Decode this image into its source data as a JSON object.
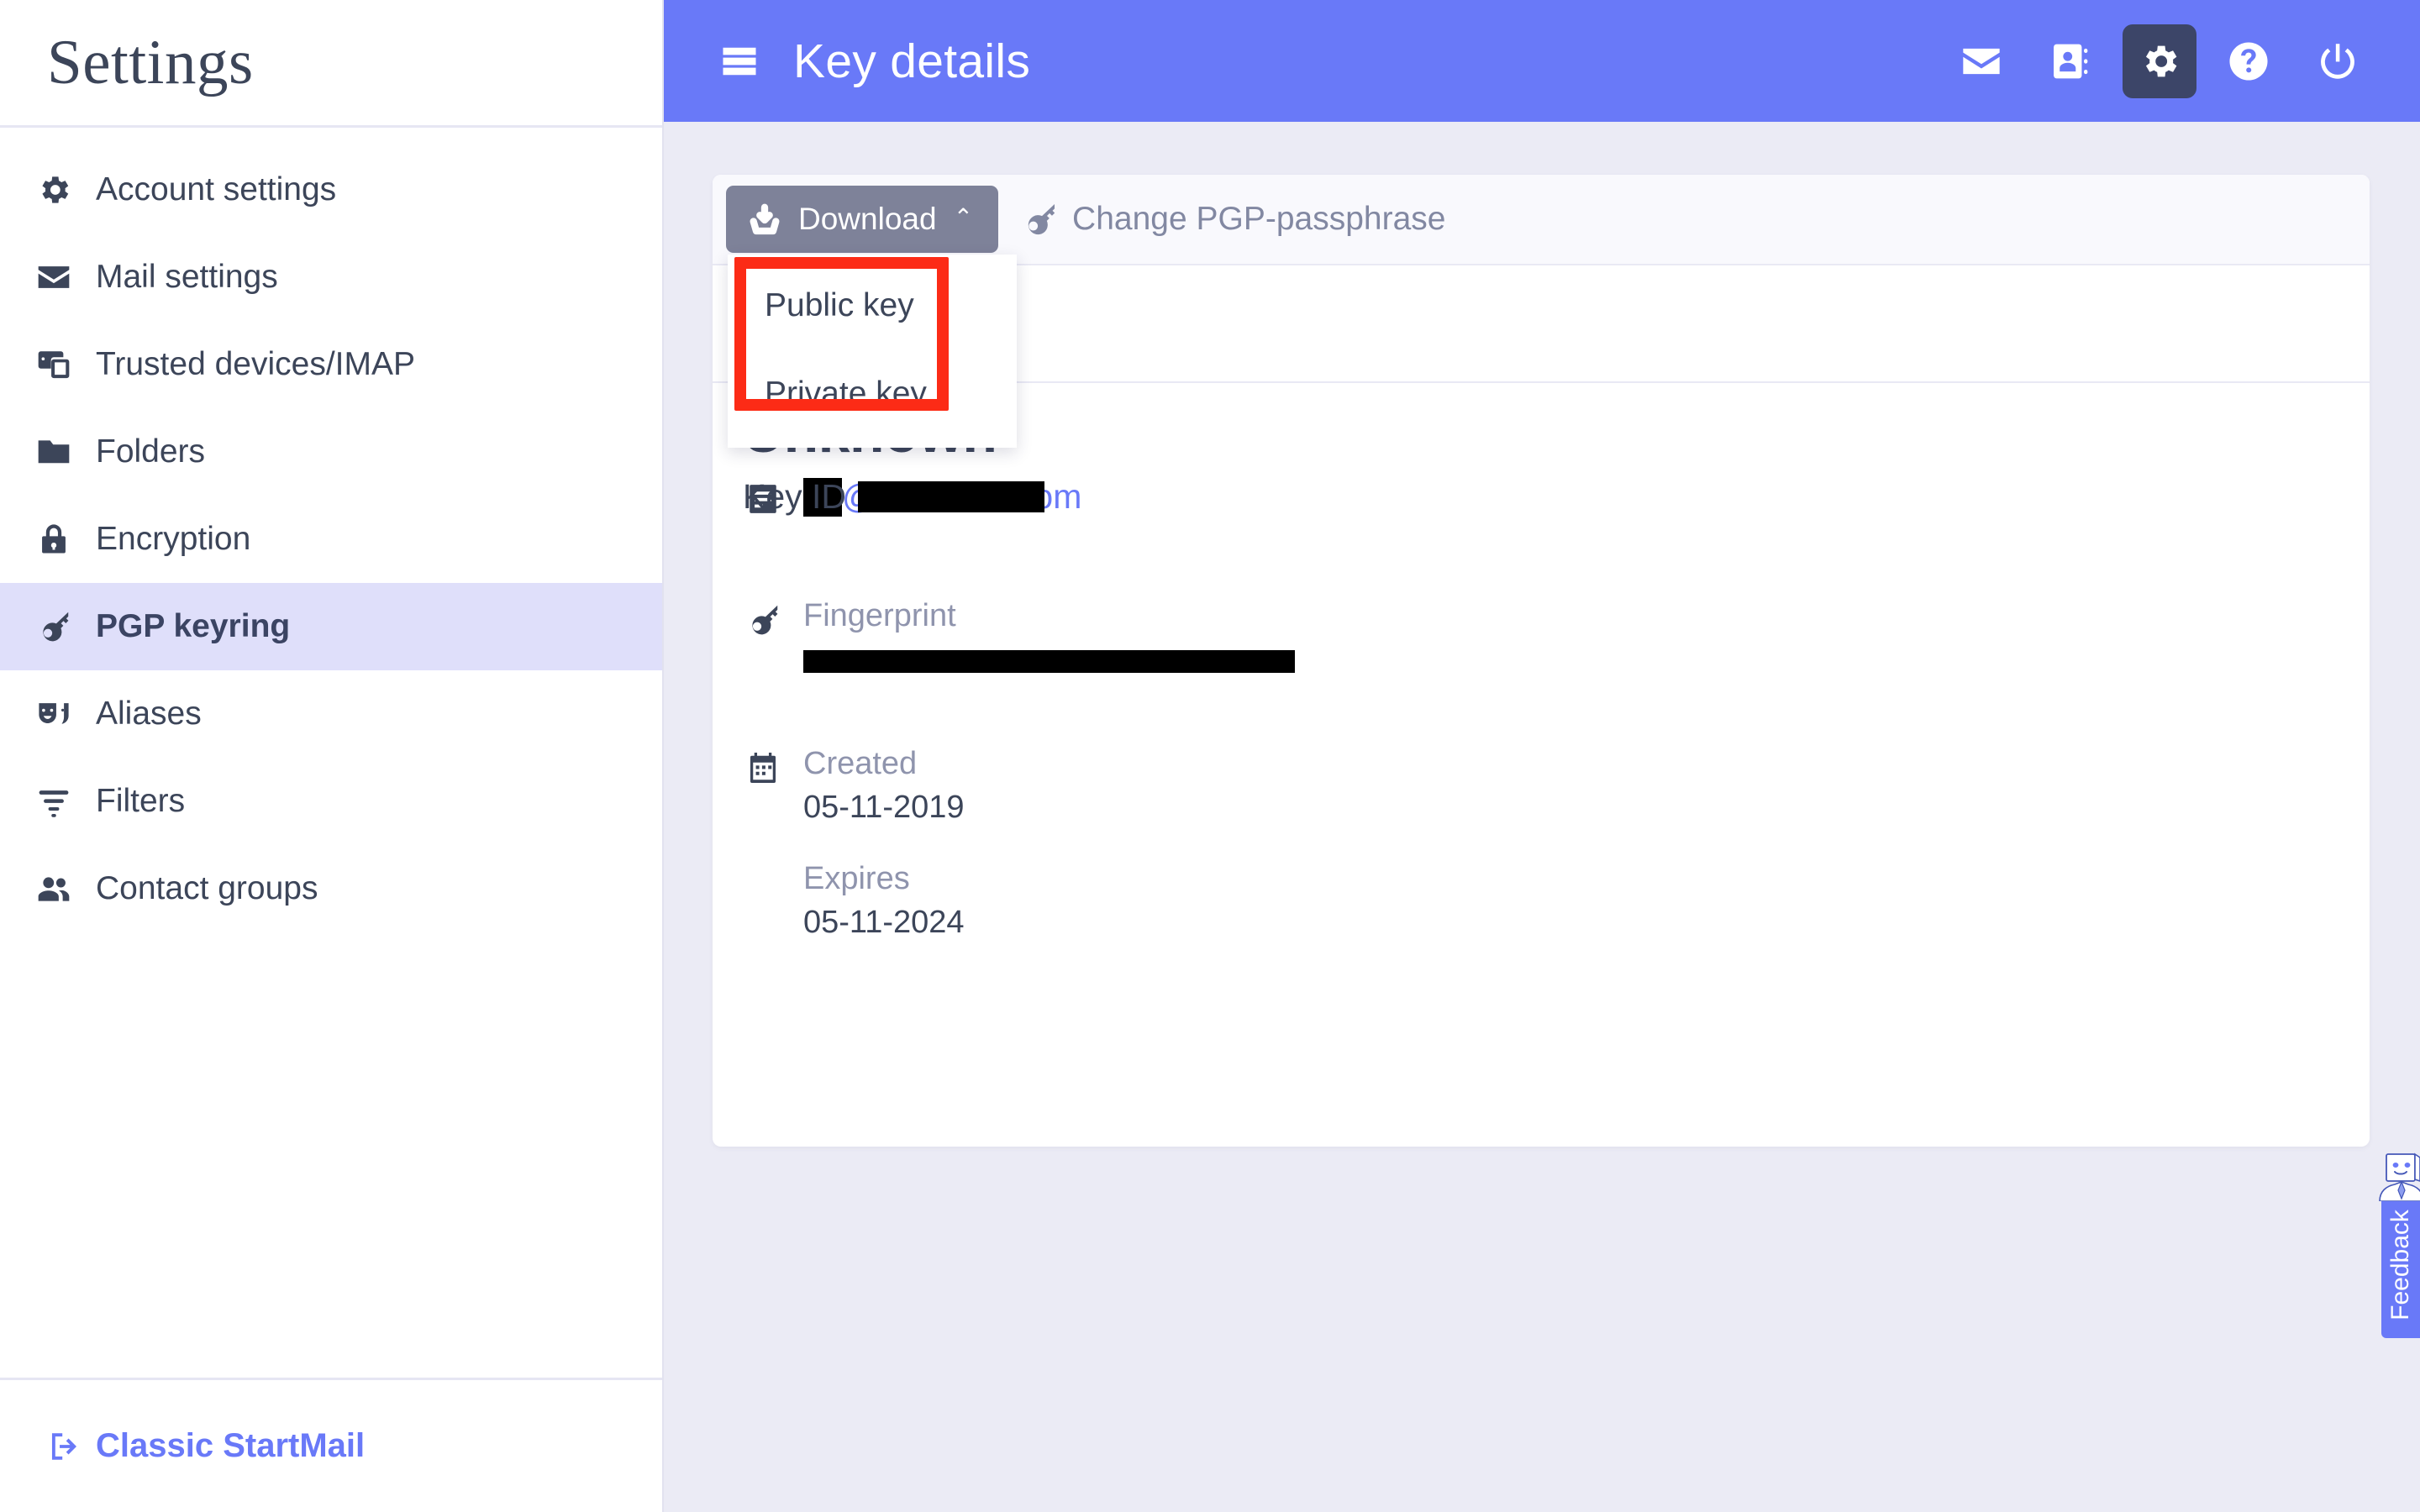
{
  "sidebar": {
    "title": "Settings",
    "items": [
      {
        "label": "Account settings",
        "icon": "gear-icon"
      },
      {
        "label": "Mail settings",
        "icon": "envelope-icon"
      },
      {
        "label": "Trusted devices/IMAP",
        "icon": "devices-icon"
      },
      {
        "label": "Folders",
        "icon": "folder-icon"
      },
      {
        "label": "Encryption",
        "icon": "lock-icon"
      },
      {
        "label": "PGP keyring",
        "icon": "key-icon",
        "active": true
      },
      {
        "label": "Aliases",
        "icon": "masks-icon"
      },
      {
        "label": "Filters",
        "icon": "filter-icon"
      },
      {
        "label": "Contact groups",
        "icon": "people-icon"
      }
    ],
    "footer_link": "Classic StartMail"
  },
  "header": {
    "menu_icon": "hamburger-icon",
    "title": "Key details",
    "actions": [
      {
        "name": "mail-icon",
        "active": false
      },
      {
        "name": "contacts-icon",
        "active": false
      },
      {
        "name": "gear-icon",
        "active": true
      },
      {
        "name": "help-icon",
        "active": false
      },
      {
        "name": "power-icon",
        "active": false
      }
    ]
  },
  "toolbar": {
    "download_label": "Download",
    "download_icon": "download-icon",
    "chevron": "⌃",
    "dropdown": {
      "open": true,
      "options": [
        "Public key",
        "Private key"
      ]
    },
    "change_passphrase_label": "Change PGP-passphrase",
    "change_passphrase_icon": "key-icon"
  },
  "key_details": {
    "name": "Unknown",
    "key_id_label": "Key ID",
    "key_id_value": "",
    "email_icon": "note-icon",
    "email_domain": "@startmail.com",
    "email_user": "",
    "fingerprint_label": "Fingerprint",
    "fingerprint_value": "",
    "fingerprint_icon": "key-icon",
    "calendar_icon": "calendar-icon",
    "created_label": "Created",
    "created_value": "05-11-2019",
    "expires_label": "Expires",
    "expires_value": "05-11-2024"
  },
  "feedback": {
    "label": "Feedback"
  },
  "colors": {
    "header_blue": "#6979f8",
    "header_active": "#3c4568",
    "sidebar_active": "#dfdffa",
    "text_dark": "#3c4559",
    "text_muted": "#8f94ad",
    "download_gray": "#7e8299",
    "annotation_red": "#fc2b16",
    "page_bg": "#ebebf5"
  }
}
